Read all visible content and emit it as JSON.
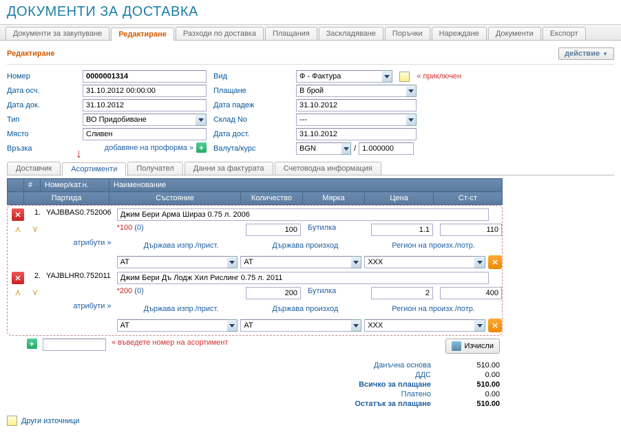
{
  "page_title": "ДОКУМЕНТИ ЗА ДОСТАВКА",
  "main_tabs": [
    "Документи за закупуване",
    "Редактиране",
    "Разходи по доставка",
    "Плащания",
    "Заскладяване",
    "Поръчки",
    "Нареждане",
    "Документи",
    "Експорт"
  ],
  "main_tab_active": 1,
  "section_title": "Редактиране",
  "action_button": "действие",
  "form": {
    "nomer_label": "Номер",
    "nomer": "0000001314",
    "vid_label": "Вид",
    "vid": "Ф - Фактура",
    "priklyuchen": "приключен",
    "data_osch_label": "Дата осч.",
    "data_osch": "31.10.2012 00:00:00",
    "plashtane_label": "Плащане",
    "plashtane": "В брой",
    "data_dok_label": "Дата док.",
    "data_dok": "31.10.2012",
    "data_padezh_label": "Дата падеж",
    "data_padezh": "31.10.2012",
    "tip_label": "Тип",
    "tip": "ВО Придобиване",
    "sklad_label": "Склад No",
    "sklad": "---",
    "myasto_label": "Място",
    "myasto": "Сливен",
    "data_dost_label": "Дата дост.",
    "data_dost": "31.10.2012",
    "vrazka_label": "Връзка",
    "add_proforma": "добавяне на проформа »",
    "valuta_label": "Валута/курс",
    "valuta": "BGN",
    "kurs": "1.000000",
    "slash": "/"
  },
  "sub_tabs": [
    "Доставчик",
    "Асортименти",
    "Получател",
    "Данни за фактурата",
    "Счетоводна информация"
  ],
  "sub_tab_active": 1,
  "cols": {
    "num": "#",
    "nomer_kat": "Номер/кат.н.",
    "naim": "Наименование",
    "partida": "Партида",
    "sast": "Състояние",
    "kol": "Количество",
    "myarka": "Мярка",
    "cena": "Цена",
    "stst": "Ст-ст"
  },
  "items": [
    {
      "n": "1.",
      "code": "YAJBBAS0.752006",
      "name": "Джим Бери Арма Шираз 0.75 л. 2006",
      "state_star": "*100",
      "state_paren": "(0)",
      "qty": "100",
      "unit": "Бутилка",
      "price": "1.1",
      "amount": "110",
      "c1": "AT",
      "c2": "AT",
      "c3": "XXX"
    },
    {
      "n": "2.",
      "code": "YAJBLHR0.752011",
      "name": "Джим Бери Дъ Лодж Хил Рислинг 0.75 л. 2011",
      "state_star": "*200",
      "state_paren": "(0)",
      "qty": "200",
      "unit": "Бутилка",
      "price": "2",
      "amount": "400",
      "c1": "AT",
      "c2": "AT",
      "c3": "XXX"
    }
  ],
  "attr_link": "атрибути »",
  "attr_h1": "Държава изпр./прист.",
  "attr_h2": "Държава произход",
  "attr_h3": "Регион на произх./потр.",
  "add_hint": "« въведете номер на асортимент",
  "calc_btn": "Изчисли",
  "totals": {
    "base_l": "Данъчна основа",
    "base_v": "510.00",
    "dds_l": "ДДС",
    "dds_v": "0.00",
    "total_l": "Всичко за плащане",
    "total_v": "510.00",
    "paid_l": "Платено",
    "paid_v": "0.00",
    "rest_l": "Остатък за плащане",
    "rest_v": "510.00"
  },
  "other_sources": "Други източници"
}
